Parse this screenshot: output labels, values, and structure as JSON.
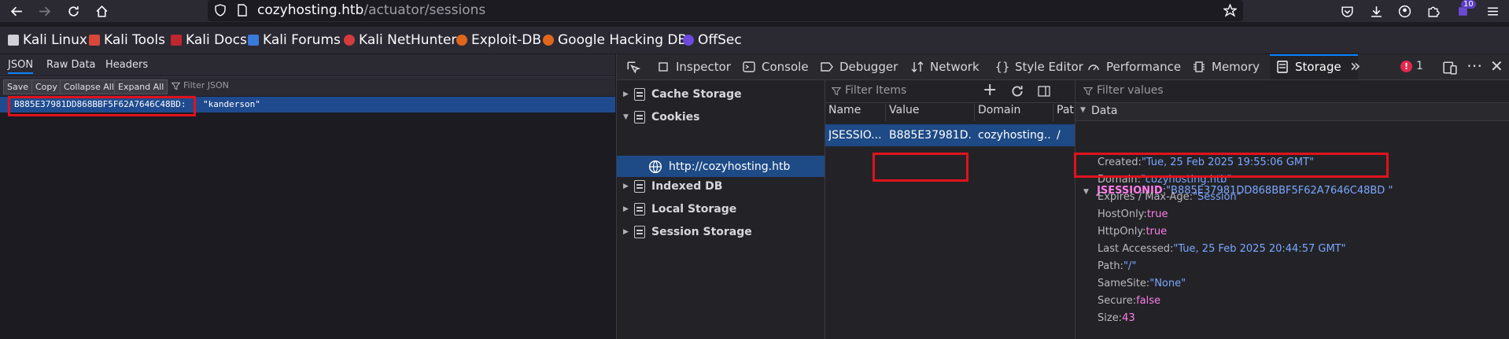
{
  "browser": {
    "url_host": "cozyhosting.htb",
    "url_path": "/actuator/sessions",
    "extension_badge": "10"
  },
  "bookmarks": [
    {
      "label": "Kali Linux",
      "icon": "kali-dragon-icon"
    },
    {
      "label": "Kali Tools",
      "icon": "kali-tools-icon"
    },
    {
      "label": "Kali Docs",
      "icon": "kali-docs-icon"
    },
    {
      "label": "Kali Forums",
      "icon": "kali-forums-icon"
    },
    {
      "label": "Kali NetHunter",
      "icon": "nethunter-icon"
    },
    {
      "label": "Exploit-DB",
      "icon": "exploit-db-icon"
    },
    {
      "label": "Google Hacking DB",
      "icon": "ghdb-icon"
    },
    {
      "label": "OffSec",
      "icon": "offsec-icon"
    }
  ],
  "json_viewer": {
    "tabs": [
      "JSON",
      "Raw Data",
      "Headers"
    ],
    "toolbar": [
      "Save",
      "Copy",
      "Collapse All",
      "Expand All"
    ],
    "filter_placeholder": "Filter JSON",
    "row": {
      "key": "B885E37981DD868BBF5F62A7646C48BD:",
      "value": "\"kanderson\""
    }
  },
  "devtools": {
    "tabs": [
      "Inspector",
      "Console",
      "Debugger",
      "Network",
      "Style Editor",
      "Performance",
      "Memory",
      "Storage"
    ],
    "error_count": "1",
    "tree": {
      "cache_storage": "Cache Storage",
      "cookies": "Cookies",
      "cookie_host": "http://cozyhosting.htb",
      "indexed_db": "Indexed DB",
      "local_storage": "Local Storage",
      "session_storage": "Session Storage"
    },
    "table": {
      "filter_placeholder": "Filter Items",
      "columns": [
        "Name",
        "Value",
        "Domain",
        "Pat"
      ],
      "row": [
        "JSESSIO...",
        "B885E37981D...",
        "cozyhosting...",
        "/"
      ]
    },
    "data": {
      "filter_placeholder": "Filter values",
      "section": "Data",
      "cookie_name": "JSESSIONID",
      "cookie_value": "\"B885E37981DD868BBF5F62A7646C48BD \"",
      "props": [
        {
          "k": "Created:",
          "v": "\"Tue, 25 Feb 2025 19:55:06 GMT\"",
          "t": "str"
        },
        {
          "k": "Domain:",
          "v": "\"cozyhosting.htb\"",
          "t": "str"
        },
        {
          "k": "Expires / Max-Age:",
          "v": "\"Session\"",
          "t": "str"
        },
        {
          "k": "HostOnly:",
          "v": "true",
          "t": "bool"
        },
        {
          "k": "HttpOnly:",
          "v": "true",
          "t": "bool"
        },
        {
          "k": "Last Accessed:",
          "v": "\"Tue, 25 Feb 2025 20:44:57 GMT\"",
          "t": "str"
        },
        {
          "k": "Path:",
          "v": "\"/\"",
          "t": "str"
        },
        {
          "k": "SameSite:",
          "v": "\"None\"",
          "t": "str"
        },
        {
          "k": "Secure:",
          "v": "false",
          "t": "bool"
        },
        {
          "k": "Size:",
          "v": "43",
          "t": "num"
        }
      ]
    }
  }
}
